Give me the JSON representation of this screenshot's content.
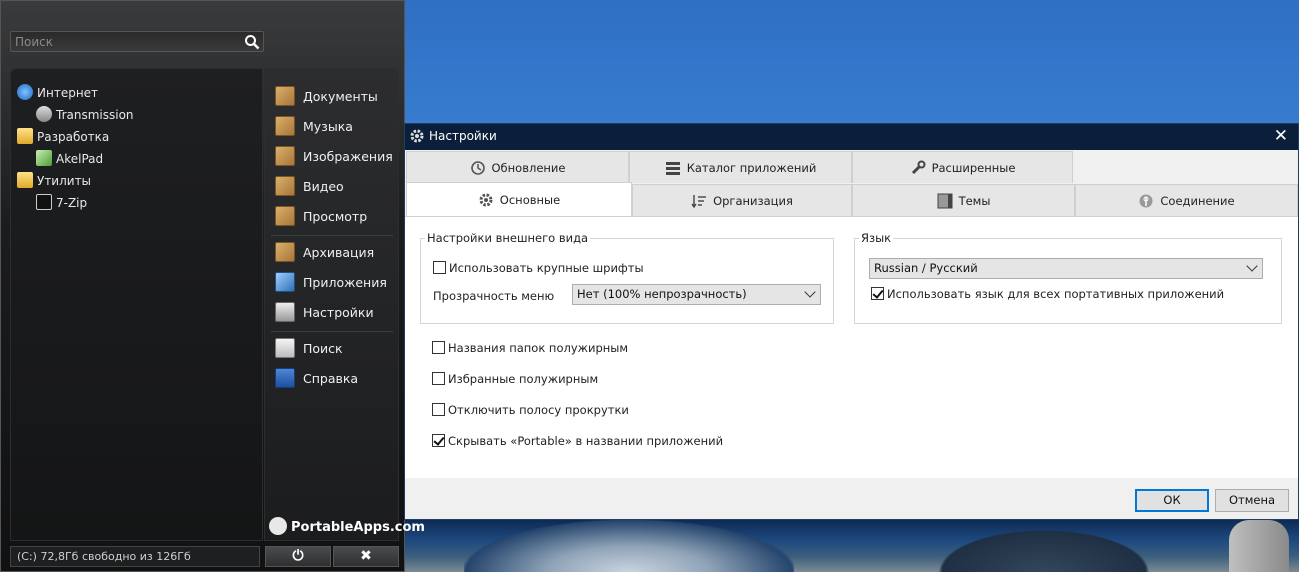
{
  "portableapps": {
    "search_placeholder": "Поиск",
    "tree": [
      {
        "label": "Интернет",
        "icon": "globe-icon"
      },
      {
        "label": "Transmission",
        "icon": "transmission-icon"
      },
      {
        "label": "Разработка",
        "icon": "folder-icon"
      },
      {
        "label": "AkelPad",
        "icon": "akelpad-icon"
      },
      {
        "label": "Утилиты",
        "icon": "folder-icon"
      },
      {
        "label": "7-Zip",
        "icon": "7zip-icon"
      }
    ],
    "nav": [
      {
        "label": "Документы",
        "icon": "documents-icon"
      },
      {
        "label": "Музыка",
        "icon": "music-icon"
      },
      {
        "label": "Изображения",
        "icon": "pictures-icon"
      },
      {
        "label": "Видео",
        "icon": "video-icon"
      },
      {
        "label": "Просмотр",
        "icon": "explore-icon"
      },
      {
        "label": "Архивация",
        "icon": "backup-icon"
      },
      {
        "label": "Приложения",
        "icon": "apps-icon"
      },
      {
        "label": "Настройки",
        "icon": "settings-icon"
      },
      {
        "label": "Поиск",
        "icon": "search-icon"
      },
      {
        "label": "Справка",
        "icon": "help-icon"
      }
    ],
    "logo_text": "PortableApps.com",
    "status": "(C:) 72,8Гб свободно из 126Гб",
    "power_label": "⏻",
    "close_label": "✖"
  },
  "dialog": {
    "title": "Настройки",
    "close_label": "✕",
    "tabs_row1": [
      {
        "label": "Обновление",
        "icon": "update-icon"
      },
      {
        "label": "Каталог приложений",
        "icon": "catalog-icon"
      },
      {
        "label": "Расширенные",
        "icon": "wrench-icon"
      }
    ],
    "tabs_row2": [
      {
        "label": "Основные",
        "icon": "gear-icon"
      },
      {
        "label": "Организация",
        "icon": "sort-icon"
      },
      {
        "label": "Темы",
        "icon": "themes-icon"
      },
      {
        "label": "Соединение",
        "icon": "connection-icon"
      }
    ],
    "appearance": {
      "title": "Настройки внешнего вида",
      "large_fonts": {
        "label": "Использовать крупные шрифты",
        "checked": false
      },
      "opacity_label": "Прозрачность меню",
      "opacity_value": "Нет (100% непрозрачность)"
    },
    "language": {
      "title": "Язык",
      "value": "Russian / Русский",
      "use_for_all": {
        "label": "Использовать язык для всех портативных приложений",
        "checked": true
      }
    },
    "options": [
      {
        "label": "Названия папок полужирным",
        "checked": false
      },
      {
        "label": "Избранные полужирным",
        "checked": false
      },
      {
        "label": "Отключить полосу прокрутки",
        "checked": false
      },
      {
        "label": "Скрывать «Portable» в названии приложений",
        "checked": true
      }
    ],
    "ok_label": "ОК",
    "cancel_label": "Отмена"
  }
}
